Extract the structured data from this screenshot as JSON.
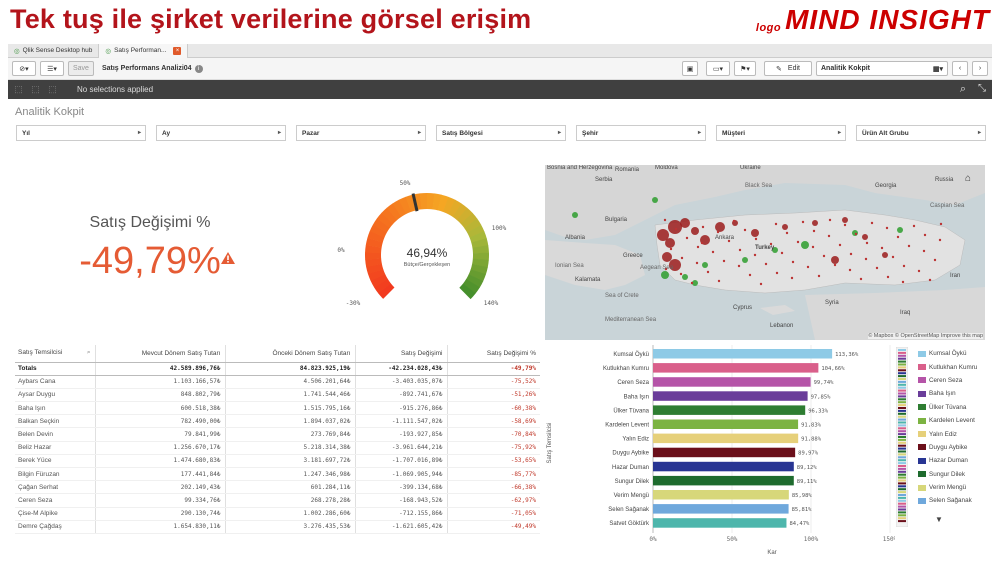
{
  "slide": {
    "title": "Tek tuş ile şirket verilerine görsel erişim",
    "logo_small": "logo",
    "logo_big": "MIND INSIGHT"
  },
  "tabs": [
    {
      "label": "Qlik Sense Desktop hub"
    },
    {
      "label": "Satış Performan..."
    }
  ],
  "toolbar": {
    "save_label": "Save",
    "sheet_name": "Satış Performans Analizi04",
    "edit_label": "Edit",
    "sheet_select": "Analitik Kokpit"
  },
  "selections": {
    "text": "No selections applied"
  },
  "sheet": {
    "title": "Analitik Kokpit"
  },
  "filters": [
    "Yıl",
    "Ay",
    "Pazar",
    "Satış Bölgesi",
    "Şehir",
    "Müşteri",
    "Ürün Alt Grubu"
  ],
  "kpi": {
    "label": "Satış Değişimi %",
    "value": "-49,79%",
    "status_color": "#e55b34"
  },
  "gauge": {
    "value_text": "46,94%",
    "subtitle": "Bütçe/Gerçekleşen",
    "ticks": [
      "-30%",
      "0%",
      "50%",
      "100%",
      "140%"
    ],
    "min": -30,
    "max": 140,
    "value": 46.94
  },
  "map": {
    "labels": {
      "bosnia": "Bosnia and Herzegovina",
      "serbia": "Serbia",
      "romania": "Romania",
      "moldova": "Moldova",
      "ukraine": "Ukraine",
      "russia": "Russia",
      "black_sea": "Black Sea",
      "georgia": "Georgia",
      "caspian": "Caspian Sea",
      "bulgaria": "Bulgaria",
      "albania": "Albania",
      "greece": "Greece",
      "turkey": "Turkey",
      "ionian": "Ionian Sea",
      "aegean": "Aegean Sea",
      "ankara": "Ankara",
      "sea_crete": "Sea of Crete",
      "kalamata": "Kalamata",
      "med": "Mediterranean Sea",
      "cyprus": "Cyprus",
      "syria": "Syria",
      "iraq": "Iraq",
      "iran": "Iran",
      "lebanon": "Lebanon"
    },
    "attribution": "© Mapbox © OpenStreetMap Improve this map"
  },
  "table": {
    "headers": [
      "Satış Temsilcisi",
      "Mevcut Dönem Satış Tutarı",
      "Önceki Dönem Satış Tutarı",
      "Satış Değişimi",
      "Satış Değişimi %"
    ],
    "totals": [
      "Totals",
      "42.589.896,76₺",
      "84.823.925,19₺",
      "-42.234.028,43₺",
      "-49,79%"
    ],
    "rows": [
      [
        "Aybars Cana",
        "1.103.166,57₺",
        "4.506.201,64₺",
        "-3.403.035,07₺",
        "-75,52%"
      ],
      [
        "Aysar Duygu",
        "848.802,79₺",
        "1.741.544,46₺",
        "-892.741,67₺",
        "-51,26%"
      ],
      [
        "Baha Işın",
        "600.518,38₺",
        "1.515.795,16₺",
        "-915.276,86₺",
        "-60,38%"
      ],
      [
        "Balkan Seçkin",
        "782.490,00₺",
        "1.894.037,02₺",
        "-1.111.547,02₺",
        "-58,69%"
      ],
      [
        "Belen Devin",
        "79.841,99₺",
        "273.769,84₺",
        "-193.927,85₺",
        "-70,84%"
      ],
      [
        "Beliz Hazar",
        "1.256.670,17₺",
        "5.218.314,38₺",
        "-3.961.644,21₺",
        "-75,92%"
      ],
      [
        "Berek Yüce",
        "1.474.680,83₺",
        "3.181.697,72₺",
        "-1.707.016,89₺",
        "-53,65%"
      ],
      [
        "Bilgin Füruzan",
        "177.441,84₺",
        "1.247.346,98₺",
        "-1.069.905,94₺",
        "-85,77%"
      ],
      [
        "Çağan Serhat",
        "202.149,43₺",
        "601.284,11₺",
        "-399.134,68₺",
        "-66,38%"
      ],
      [
        "Ceren Seza",
        "99.334,76₺",
        "268.278,28₺",
        "-168.943,52₺",
        "-62,97%"
      ],
      [
        "Çise-M Alpike",
        "290.130,74₺",
        "1.002.286,60₺",
        "-712.155,86₺",
        "-71,05%"
      ],
      [
        "Demre Çağdaş",
        "1.654.830,11₺",
        "3.276.435,53₺",
        "-1.621.605,42₺",
        "-49,49%"
      ]
    ]
  },
  "chart_data": {
    "type": "bar",
    "orientation": "horizontal",
    "categories": [
      "Kumsal Öykü",
      "Kutlukhan Kumru",
      "Ceren Seza",
      "Baha Işın",
      "Ülker Tüvana",
      "Kardelen Levent",
      "Yalın Ediz",
      "Duygu Aybike",
      "Hazar Duman",
      "Sungur Dilek",
      "Verim Mengü",
      "Selen Sağanak",
      "Satvet Göktürk"
    ],
    "values": [
      113.36,
      104.66,
      99.74,
      97.85,
      96.33,
      91.83,
      91.88,
      89.97,
      89.12,
      89.11,
      85.98,
      85.81,
      84.47
    ],
    "value_labels": [
      "113,36%",
      "104,66%",
      "99,74%",
      "97,85%",
      "96,33%",
      "91,83%",
      "91,88%",
      "89,97%",
      "89,12%",
      "89,11%",
      "85,98%",
      "85,81%",
      "84,47%"
    ],
    "colors": [
      "#8ecae6",
      "#d95f8a",
      "#b554a8",
      "#6a3d9a",
      "#2e7d32",
      "#7cb342",
      "#e6d07a",
      "#6b0f1a",
      "#283593",
      "#1e6b2e",
      "#d7d77a",
      "#6fa8dc",
      "#4db6ac"
    ],
    "xlabel": "Kar",
    "ylabel": "Satış Temsilcisi",
    "xlim": [
      0,
      150
    ],
    "xticks": [
      "0%",
      "50%",
      "100%",
      "150%"
    ],
    "xtick_values": [
      0,
      50,
      100,
      150
    ]
  },
  "legend": {
    "items": [
      {
        "label": "Kumsal Öykü",
        "color": "#8ecae6"
      },
      {
        "label": "Kutlukhan Kumru",
        "color": "#d95f8a"
      },
      {
        "label": "Ceren Seza",
        "color": "#b554a8"
      },
      {
        "label": "Baha Işın",
        "color": "#6a3d9a"
      },
      {
        "label": "Ülker Tüvana",
        "color": "#2e7d32"
      },
      {
        "label": "Kardelen Levent",
        "color": "#7cb342"
      },
      {
        "label": "Yalın Ediz",
        "color": "#e6d07a"
      },
      {
        "label": "Duygu Aybike",
        "color": "#6b0f1a"
      },
      {
        "label": "Hazar Duman",
        "color": "#283593"
      },
      {
        "label": "Sungur Dilek",
        "color": "#1e6b2e"
      },
      {
        "label": "Verim Mengü",
        "color": "#d7d77a"
      },
      {
        "label": "Selen Sağanak",
        "color": "#6fa8dc"
      }
    ]
  }
}
